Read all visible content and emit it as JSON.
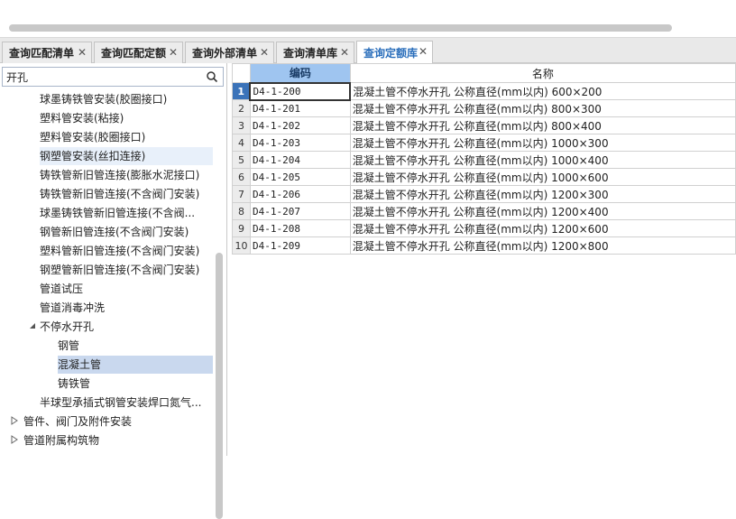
{
  "tabs": [
    {
      "label": "查询匹配清单",
      "active": false
    },
    {
      "label": "查询匹配定额",
      "active": false
    },
    {
      "label": "查询外部清单",
      "active": false
    },
    {
      "label": "查询清单库",
      "active": false
    },
    {
      "label": "查询定额库",
      "active": true
    }
  ],
  "close_glyph": "✕",
  "search": {
    "value": "开孔",
    "icon": "search-icon"
  },
  "tree": [
    {
      "label": "球墨铸铁管安装(胶圈接口)",
      "level": 2
    },
    {
      "label": "塑料管安装(粘接)",
      "level": 2
    },
    {
      "label": "塑料管安装(胶圈接口)",
      "level": 2
    },
    {
      "label": "钢塑管安装(丝扣连接)",
      "level": 2,
      "state": "hover"
    },
    {
      "label": "铸铁管新旧管连接(膨胀水泥接口)",
      "level": 2
    },
    {
      "label": "铸铁管新旧管连接(不含阀门安装)",
      "level": 2
    },
    {
      "label": "球墨铸铁管新旧管连接(不含阀...",
      "level": 2
    },
    {
      "label": "钢管新旧管连接(不含阀门安装)",
      "level": 2
    },
    {
      "label": "塑料管新旧管连接(不含阀门安装)",
      "level": 2
    },
    {
      "label": "钢塑管新旧管连接(不含阀门安装)",
      "level": 2
    },
    {
      "label": "管道试压",
      "level": 2
    },
    {
      "label": "管道消毒冲洗",
      "level": 2
    },
    {
      "label": "不停水开孔",
      "level": 2,
      "expander": "expanded"
    },
    {
      "label": "钢管",
      "level": 3
    },
    {
      "label": "混凝土管",
      "level": 3,
      "state": "selected"
    },
    {
      "label": "铸铁管",
      "level": 3
    },
    {
      "label": "半球型承插式钢管安装焊口氮气...",
      "level": 2
    },
    {
      "label": "管件、阀门及附件安装",
      "level": 1,
      "expander": "collapsed"
    },
    {
      "label": "管道附属构筑物",
      "level": 1,
      "expander": "collapsed"
    }
  ],
  "grid": {
    "headers": {
      "code": "编码",
      "name": "名称"
    },
    "rows": [
      {
        "num": "1",
        "code": "D4-1-200",
        "name": "混凝土管不停水开孔 公称直径(mm以内) 600×200"
      },
      {
        "num": "2",
        "code": "D4-1-201",
        "name": "混凝土管不停水开孔 公称直径(mm以内) 800×300"
      },
      {
        "num": "3",
        "code": "D4-1-202",
        "name": "混凝土管不停水开孔 公称直径(mm以内) 800×400"
      },
      {
        "num": "4",
        "code": "D4-1-203",
        "name": "混凝土管不停水开孔 公称直径(mm以内) 1000×300"
      },
      {
        "num": "5",
        "code": "D4-1-204",
        "name": "混凝土管不停水开孔 公称直径(mm以内) 1000×400"
      },
      {
        "num": "6",
        "code": "D4-1-205",
        "name": "混凝土管不停水开孔 公称直径(mm以内) 1000×600"
      },
      {
        "num": "7",
        "code": "D4-1-206",
        "name": "混凝土管不停水开孔 公称直径(mm以内) 1200×300"
      },
      {
        "num": "8",
        "code": "D4-1-207",
        "name": "混凝土管不停水开孔 公称直径(mm以内) 1200×400"
      },
      {
        "num": "9",
        "code": "D4-1-208",
        "name": "混凝土管不停水开孔 公称直径(mm以内) 1200×600"
      },
      {
        "num": "10",
        "code": "D4-1-209",
        "name": "混凝土管不停水开孔 公称直径(mm以内) 1200×800"
      }
    ]
  },
  "colors": {
    "active_tab_text": "#2a6ebb",
    "header_code_bg": "#9fc5f0",
    "selected_row_bg": "#c9d8ee",
    "row_one_bg": "#3b73b9"
  }
}
